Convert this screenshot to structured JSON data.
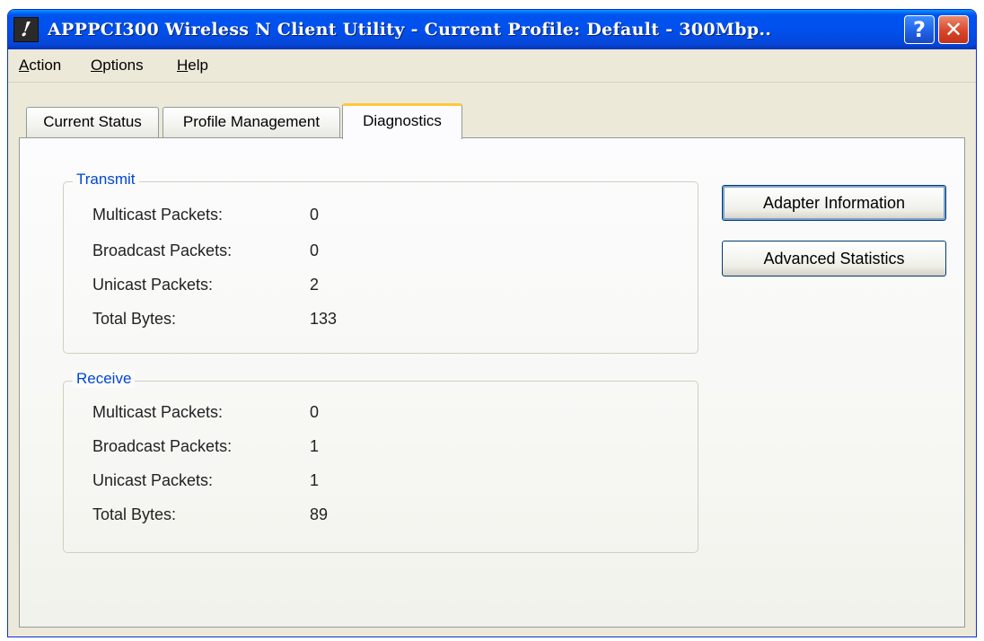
{
  "window": {
    "title": "APPPCI300 Wireless N Client Utility - Current Profile: Default - 300Mbp..",
    "help_glyph": "?",
    "close_glyph": "✕",
    "app_icon_glyph": "!"
  },
  "menu": [
    "Action",
    "Options",
    "Help"
  ],
  "tabs": [
    {
      "label": "Current Status",
      "active": false
    },
    {
      "label": "Profile Management",
      "active": false
    },
    {
      "label": "Diagnostics",
      "active": true
    }
  ],
  "transmit": {
    "title": "Transmit",
    "rows": [
      {
        "label": "Multicast Packets:",
        "value": "0"
      },
      {
        "label": "Broadcast Packets:",
        "value": "0"
      },
      {
        "label": "Unicast Packets:",
        "value": "2"
      },
      {
        "label": "Total Bytes:",
        "value": "133"
      }
    ]
  },
  "receive": {
    "title": "Receive",
    "rows": [
      {
        "label": "Multicast Packets:",
        "value": "0"
      },
      {
        "label": "Broadcast Packets:",
        "value": "1"
      },
      {
        "label": "Unicast Packets:",
        "value": "1"
      },
      {
        "label": "Total Bytes:",
        "value": "89"
      }
    ]
  },
  "buttons": {
    "adapter_information": "Adapter Information",
    "advanced_statistics": "Advanced Statistics"
  },
  "colors": {
    "titlebar": "#0053ee",
    "group_title": "#0046d5",
    "tab_highlight": "#ffc83c"
  }
}
